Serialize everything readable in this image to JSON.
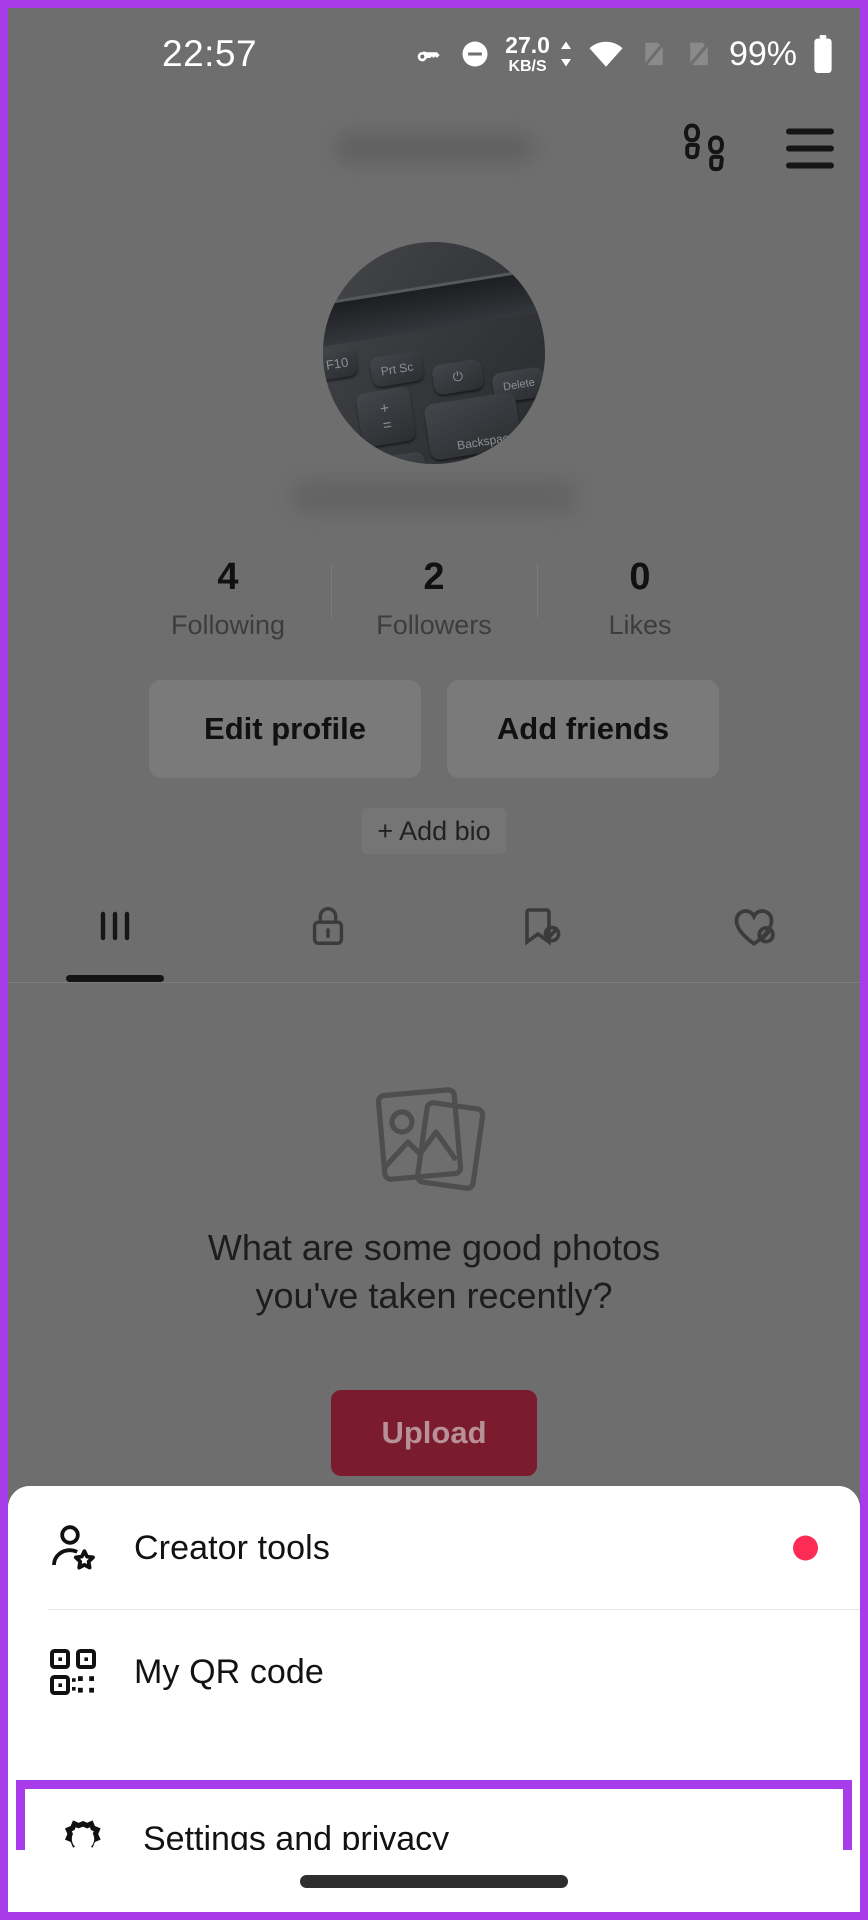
{
  "status_bar": {
    "time": "22:57",
    "network_speed_value": "27.0",
    "network_speed_unit": "KB/S",
    "battery_percent": "99%",
    "icons": [
      "vpn-key-icon",
      "do-not-disturb-icon",
      "network-speed-indicator",
      "wifi-icon",
      "sim-none-icon-1",
      "sim-none-icon-2",
      "battery-icon"
    ]
  },
  "profile": {
    "username_redacted": "",
    "handle_redacted": "",
    "avatar_alt": "laptop keyboard photo",
    "topbar_icons": [
      "footprints-icon",
      "hamburger-menu-icon"
    ],
    "stats": [
      {
        "count": "4",
        "label": "Following"
      },
      {
        "count": "2",
        "label": "Followers"
      },
      {
        "count": "0",
        "label": "Likes"
      }
    ],
    "buttons": {
      "edit_profile": "Edit profile",
      "add_friends": "Add friends",
      "add_bio": "+ Add bio"
    },
    "tabs": [
      {
        "name": "posts-tab",
        "icon": "grid-posts-icon",
        "active": true
      },
      {
        "name": "private-tab",
        "icon": "lock-icon",
        "active": false
      },
      {
        "name": "saved-tab",
        "icon": "bookmark-hidden-icon",
        "active": false
      },
      {
        "name": "liked-tab",
        "icon": "heart-hidden-icon",
        "active": false
      }
    ],
    "empty_state": {
      "icon": "photos-stack-icon",
      "prompt": "What are some good photos you've taken recently?",
      "upload_label": "Upload"
    }
  },
  "bottom_sheet": {
    "items": [
      {
        "icon": "creator-tools-icon",
        "label": "Creator tools",
        "badge": "dot"
      },
      {
        "icon": "qr-code-icon",
        "label": "My QR code",
        "badge": ""
      },
      {
        "icon": "gear-icon",
        "label": "Settings and privacy",
        "badge": ""
      }
    ]
  },
  "annotation": {
    "highlight_color": "#a83ceb",
    "target_label": "Settings and privacy"
  },
  "colors": {
    "accent_red": "#fe2c55",
    "upload_button": "#7b1b2e",
    "scrim": "#6e6e6e",
    "sheet_background": "#ffffff"
  },
  "system_nav": {
    "gesture_pill": "home-gesture-pill"
  }
}
